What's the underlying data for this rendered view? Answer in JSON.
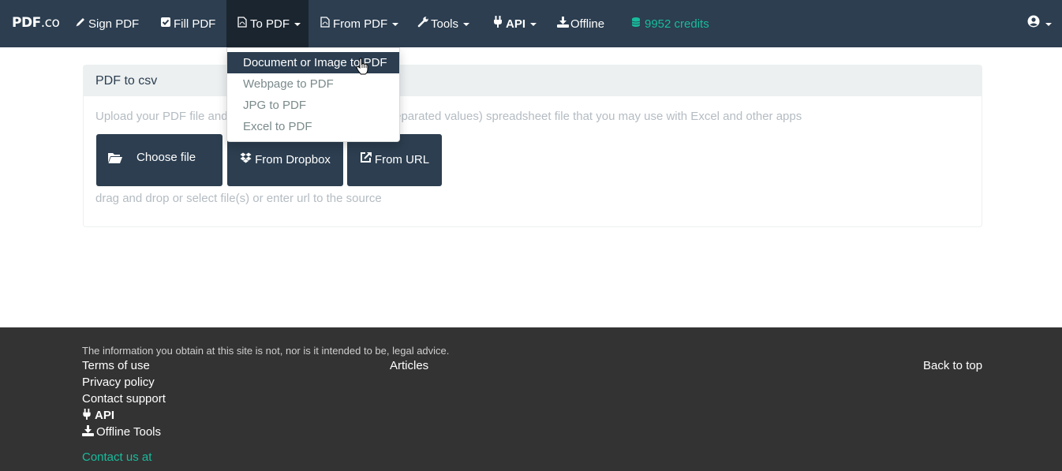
{
  "nav": {
    "brand_main": "PDF",
    "brand_suffix": ".co",
    "items": [
      {
        "label": "Sign PDF",
        "icon": "pencil-icon"
      },
      {
        "label": "Fill PDF",
        "icon": "check-square-icon"
      },
      {
        "label": "To PDF",
        "icon": "pdf-file-icon"
      },
      {
        "label": "From PDF",
        "icon": "pdf-file-icon"
      },
      {
        "label": "Tools",
        "icon": "wrench-icon"
      },
      {
        "label": "API",
        "icon": "plug-icon"
      },
      {
        "label": "Offline",
        "icon": "download-icon"
      }
    ],
    "credits": "9952 credits",
    "credits_icon": "coins-icon",
    "user_icon": "user-circle-icon"
  },
  "dropdown": {
    "items": [
      {
        "label": "Document or Image to PDF",
        "state": "hovered"
      },
      {
        "label": "Webpage to PDF"
      },
      {
        "label": "JPG to PDF"
      },
      {
        "label": "Excel to PDF"
      }
    ]
  },
  "panel": {
    "title": "PDF to csv",
    "desc_start": "Upload your PDF file and",
    "desc_end": "ma-separated values) spreadsheet file that you may use with Excel and other apps",
    "choose_label": "Choose file",
    "dropbox_label": "From Dropbox",
    "url_label": "From URL",
    "drag_hint": "drag and drop or select file(s) or enter url to the source"
  },
  "footer": {
    "disclaimer": "The information you obtain at this site is not, nor is it intended to be, legal advice.",
    "terms": "Terms of use",
    "privacy": "Privacy policy",
    "support": "Contact support",
    "api": "API",
    "offline_tools": "Offline Tools",
    "contact": "Contact us at",
    "articles": "Articles",
    "back_to_top": "Back to top"
  },
  "colors": {
    "navbar": "#2c3e50",
    "accent": "#18bc9c",
    "footer": "#333333",
    "muted_text": "#b4bcc2"
  }
}
